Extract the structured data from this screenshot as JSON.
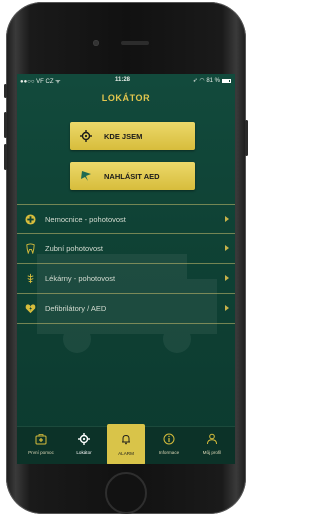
{
  "status_bar": {
    "carrier": "●●○○ VF CZ ᯤ",
    "time": "11:28",
    "battery": "➶ ◠ 81 %"
  },
  "header": {
    "title": "LOKÁTOR"
  },
  "actions": [
    {
      "label": "KDE JSEM",
      "icon": "locate-icon"
    },
    {
      "label": "NAHLÁSIT AED",
      "icon": "flag-icon"
    }
  ],
  "list": [
    {
      "label": "Nemocnice - pohotovost",
      "icon": "hospital-icon"
    },
    {
      "label": "Zubní pohotovost",
      "icon": "tooth-icon"
    },
    {
      "label": "Lékárny - pohotovost",
      "icon": "pharmacy-icon"
    },
    {
      "label": "Defibrilátory / AED",
      "icon": "heart-bolt-icon"
    }
  ],
  "tabs": [
    {
      "label": "První pomoc",
      "icon": "first-aid-kit-icon"
    },
    {
      "label": "Lokátor",
      "icon": "locate-icon"
    },
    {
      "label": "ALARM",
      "icon": "bell-icon"
    },
    {
      "label": "Informace",
      "icon": "info-icon"
    },
    {
      "label": "Můj profil",
      "icon": "profile-icon"
    }
  ],
  "colors": {
    "background": "#0f4235",
    "accent": "#d7bd3c",
    "title": "#e2c64e",
    "tabbar": "#0c3228"
  }
}
